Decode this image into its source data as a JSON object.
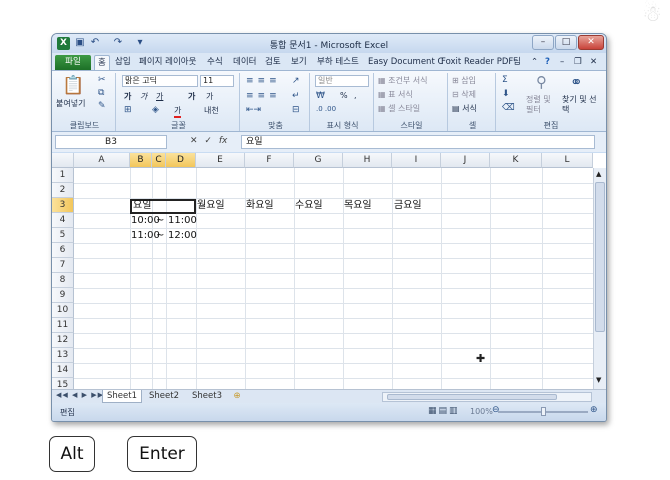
{
  "window": {
    "title": "통합 문서1 - Microsoft Excel",
    "app_icon": "X",
    "controls": {
      "minimize": "–",
      "maximize": "□",
      "close": "✕"
    }
  },
  "ribbon_tabs": [
    "홈",
    "삽입",
    "페이지 레이아웃",
    "수식",
    "데이터",
    "검토",
    "보기",
    "부하 테스트",
    "Easy Document C",
    "Foxit Reader PDF",
    "팀"
  ],
  "file_tab": "파일",
  "ribbon": {
    "clipboard": {
      "paste": "붙여넣기",
      "label": "클립보드"
    },
    "font": {
      "name": "맑은 고딕",
      "size": "11",
      "label": "글꼴",
      "bold": "가",
      "italic": "가",
      "underline": "가",
      "grow": "가",
      "shrink": "가",
      "color": "가",
      "phonetic": "내천"
    },
    "alignment": {
      "label": "맞춤"
    },
    "number": {
      "format": "일반",
      "percent": "%",
      "comma": ",",
      "label": "표시 형식"
    },
    "styles": {
      "conditional": "조건부 서식",
      "table": "표 서식",
      "cell": "셀 스타일",
      "label": "스타일"
    },
    "cells": {
      "insert": "삽입",
      "delete": "삭제",
      "format": "서식",
      "label": "셀"
    },
    "editing": {
      "sort": "정렬 및 필터",
      "find": "찾기 및 선택",
      "label": "편집"
    }
  },
  "formula_bar": {
    "name_box": "B3",
    "formula": "요일"
  },
  "columns": [
    "A",
    "B",
    "C",
    "D",
    "E",
    "F",
    "G",
    "H",
    "I",
    "J",
    "K",
    "L"
  ],
  "rows": [
    "1",
    "2",
    "3",
    "4",
    "5",
    "6",
    "7",
    "8",
    "9",
    "10",
    "11",
    "12",
    "13",
    "14",
    "15"
  ],
  "cells": {
    "b3": "요일",
    "e3": "월요일",
    "f3": "화요일",
    "g3": "수요일",
    "h3": "목요일",
    "i3": "금요일",
    "b4": "10:00",
    "c4": "~",
    "d4": "11:00",
    "b5": "11:00",
    "c5": "~",
    "d5": "12:00"
  },
  "sheets": [
    "Sheet1",
    "Sheet2",
    "Sheet3"
  ],
  "status": {
    "mode": "편집",
    "zoom": "100%"
  },
  "keys": [
    "Alt",
    "Enter"
  ]
}
